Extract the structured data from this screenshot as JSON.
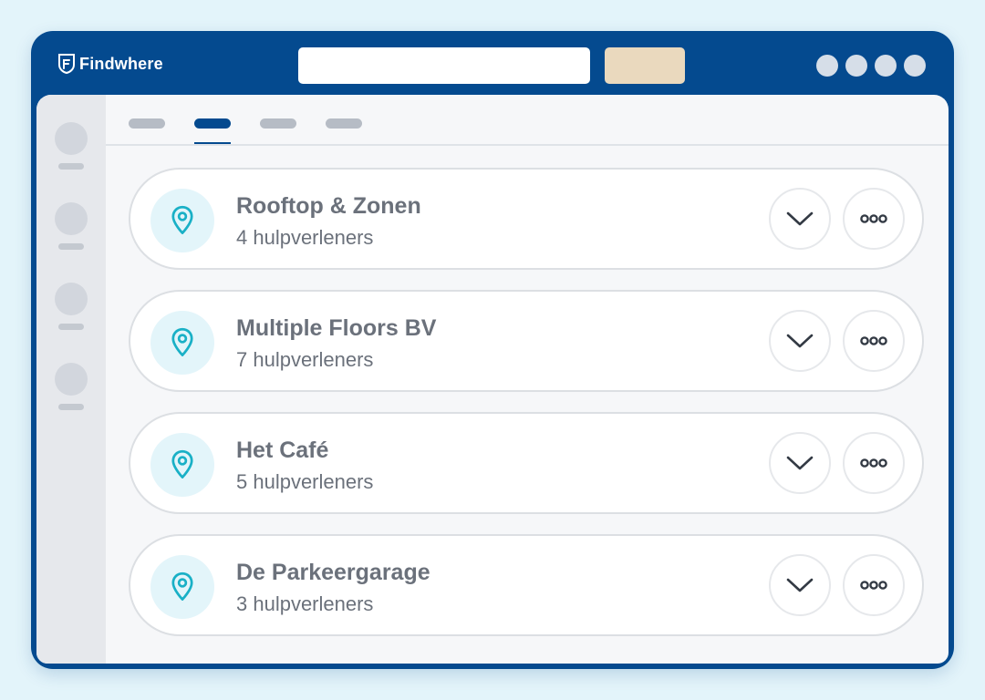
{
  "header": {
    "brand_name": "Findwhere",
    "search": {
      "value": "",
      "placeholder": ""
    },
    "search_button_label": "",
    "colors": {
      "header_bg": "#044a8f",
      "search_button": "#ead9be"
    },
    "window_controls": [
      "dot",
      "dot",
      "dot",
      "dot"
    ]
  },
  "sidebar": {
    "items": [
      "",
      "",
      "",
      ""
    ]
  },
  "tabs": {
    "items": [
      "",
      "",
      "",
      ""
    ],
    "active_index": 1
  },
  "locations": [
    {
      "name": "Rooftop & Zonen",
      "helpers": "4 hulpverleners",
      "icon": "location-pin-icon"
    },
    {
      "name": "Multiple Floors BV",
      "helpers": "7 hulpverleners",
      "icon": "location-pin-icon"
    },
    {
      "name": "Het Café",
      "helpers": "5 hulpverleners",
      "icon": "location-pin-icon"
    },
    {
      "name": "De Parkeergarage",
      "helpers": "3 hulpverleners",
      "icon": "location-pin-icon"
    }
  ],
  "actions": {
    "expand_icon": "chevron-down-icon",
    "more_icon": "more-options-icon"
  },
  "colors": {
    "accent": "#044a8f",
    "pin": "#19b0c6",
    "pin_bg": "#e3f5fa",
    "text": "#6b717b"
  }
}
